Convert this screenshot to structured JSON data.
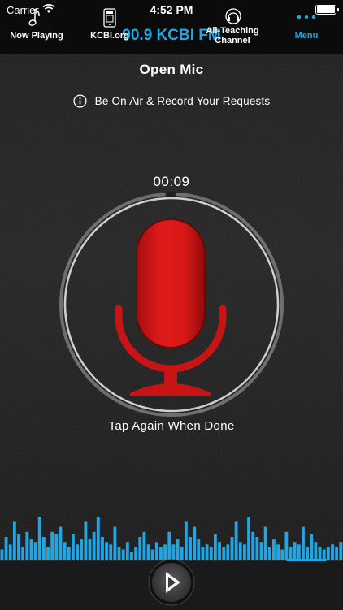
{
  "status_bar": {
    "carrier": "Carrier",
    "time": "4:52 PM"
  },
  "header": {
    "station": "90.9 KCBI FM"
  },
  "screen": {
    "title": "Open Mic",
    "subtitle": "Be On Air & Record Your Requests",
    "timer": "00:09",
    "hint": "Tap Again When Done"
  },
  "tabs": [
    {
      "label": "Now Playing",
      "icon": "music-note-icon"
    },
    {
      "label": "KCBI.org",
      "icon": "phone-icon"
    },
    {
      "label": "All-Teaching\nChannel",
      "icon": "headphones-icon"
    },
    {
      "label": "Menu",
      "icon": "dots-icon"
    }
  ],
  "colors": {
    "accent": "#1fa6e3",
    "mic_red": "#e01a1a",
    "background": "#0b0b0b"
  },
  "equalizer_levels": [
    0.25,
    0.5,
    0.35,
    0.8,
    0.55,
    0.3,
    0.6,
    0.45,
    0.4,
    0.9,
    0.5,
    0.3,
    0.6,
    0.55,
    0.7,
    0.4,
    0.3,
    0.55,
    0.35,
    0.45,
    0.8,
    0.45,
    0.6,
    0.9,
    0.5,
    0.4,
    0.35,
    0.7,
    0.3,
    0.25,
    0.4,
    0.2,
    0.3,
    0.5,
    0.6,
    0.35,
    0.25,
    0.4,
    0.3,
    0.35,
    0.6,
    0.35,
    0.45,
    0.3,
    0.8,
    0.5,
    0.7,
    0.45,
    0.3,
    0.35,
    0.3,
    0.55,
    0.4,
    0.3,
    0.35,
    0.5,
    0.8,
    0.4,
    0.35,
    0.9,
    0.6,
    0.5,
    0.4,
    0.7,
    0.3,
    0.45,
    0.35,
    0.25,
    0.6,
    0.3,
    0.4,
    0.35,
    0.7,
    0.3,
    0.55,
    0.4,
    0.3,
    0.25,
    0.3,
    0.35,
    0.3,
    0.4
  ]
}
